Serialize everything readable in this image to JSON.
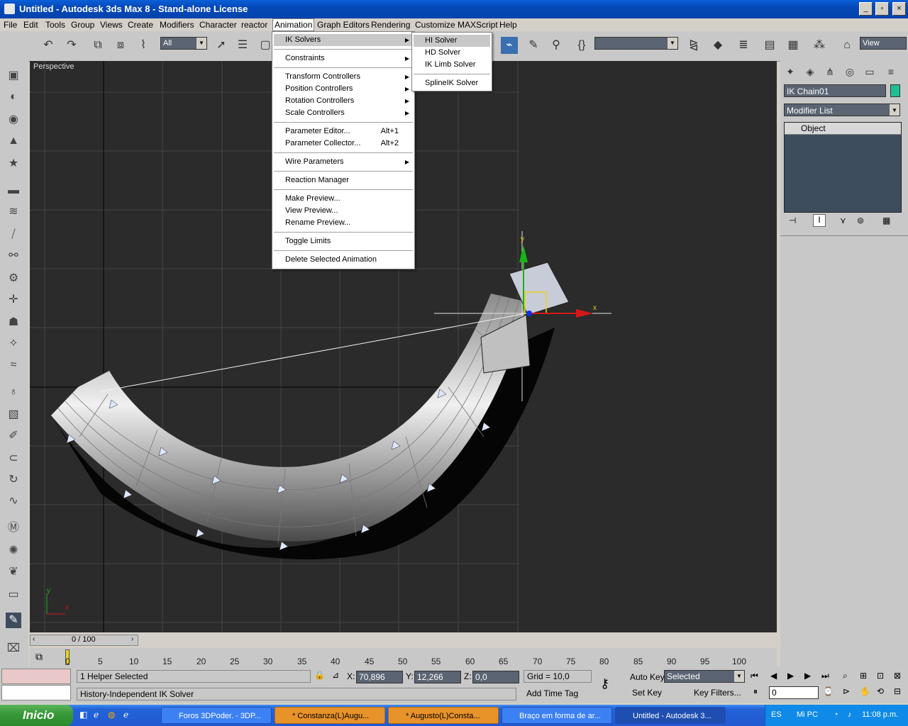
{
  "window": {
    "title": "Untitled - Autodesk 3ds Max 8  - Stand-alone License",
    "buttons": [
      "_",
      "▫",
      "×"
    ]
  },
  "menubar": [
    "File",
    "Edit",
    "Tools",
    "Group",
    "Views",
    "Create",
    "Modifiers",
    "Character",
    "reactor",
    "Animation",
    "Graph Editors",
    "Rendering",
    "Customize",
    "MAXScript",
    "Help"
  ],
  "toolbar": {
    "selection_filter": "All",
    "named_selection": "",
    "ref_coord": "View"
  },
  "animation_menu": [
    {
      "label": "IK Solvers",
      "sub": true,
      "hl": true
    },
    {
      "sep": true
    },
    {
      "label": "Constraints",
      "sub": true
    },
    {
      "sep": true
    },
    {
      "label": "Transform Controllers",
      "sub": true
    },
    {
      "label": "Position Controllers",
      "sub": true
    },
    {
      "label": "Rotation Controllers",
      "sub": true
    },
    {
      "label": "Scale Controllers",
      "sub": true
    },
    {
      "sep": true
    },
    {
      "label": "Parameter Editor...",
      "shortcut": "Alt+1"
    },
    {
      "label": "Parameter Collector...",
      "shortcut": "Alt+2"
    },
    {
      "sep": true
    },
    {
      "label": "Wire Parameters",
      "sub": true
    },
    {
      "sep": true
    },
    {
      "label": "Reaction Manager"
    },
    {
      "sep": true
    },
    {
      "label": "Make Preview..."
    },
    {
      "label": "View Preview..."
    },
    {
      "label": "Rename Preview..."
    },
    {
      "sep": true
    },
    {
      "label": "Toggle Limits"
    },
    {
      "sep": true
    },
    {
      "label": "Delete Selected Animation"
    }
  ],
  "ik_submenu": [
    {
      "label": "HI Solver",
      "hl": true
    },
    {
      "label": "HD Solver"
    },
    {
      "label": "IK Limb Solver"
    },
    {
      "sep": true
    },
    {
      "label": "SplineIK Solver"
    }
  ],
  "viewport": {
    "label": "Perspective",
    "axis_x": "x",
    "axis_y": "y",
    "gizmo_x": "x",
    "gizmo_y": "y"
  },
  "command_panel": {
    "object_name": "IK Chain01",
    "modifier_list": "Modifier List",
    "stack_item": "Object",
    "object_color": "#1fbe93"
  },
  "time": {
    "frame": "0 / 100",
    "ticks": [
      "0",
      "5",
      "10",
      "15",
      "20",
      "25",
      "30",
      "35",
      "40",
      "45",
      "50",
      "55",
      "60",
      "65",
      "70",
      "75",
      "80",
      "85",
      "90",
      "95",
      "100"
    ]
  },
  "status": {
    "selection": "1 Helper Selected",
    "prompt": "History-Independent IK Solver",
    "x_label": "X:",
    "x": "70,896",
    "y_label": "Y:",
    "y": "12,266",
    "z_label": "Z:",
    "z": "0,0",
    "grid": "Grid = 10,0",
    "add_time_tag": "Add Time Tag",
    "auto_key": "Auto Key",
    "set_key": "Set Key",
    "key_mode": "Selected",
    "key_filters": "Key Filters...",
    "current_frame": "0"
  },
  "taskbar": {
    "start": "Inicio",
    "tasks": [
      {
        "label": "Foros 3DPoder. - 3DP...",
        "style": "blue"
      },
      {
        "label": "* Constanza(L)Augu...",
        "style": "orange"
      },
      {
        "label": "* Augusto(L)Consta...",
        "style": "orange"
      },
      {
        "label": "Braço em forma de ar...",
        "style": "blue"
      },
      {
        "label": "Untitled - Autodesk 3...",
        "style": "active"
      }
    ],
    "lang": "ES",
    "mypc": "Mi PC",
    "clock": "11:08 p.m."
  }
}
